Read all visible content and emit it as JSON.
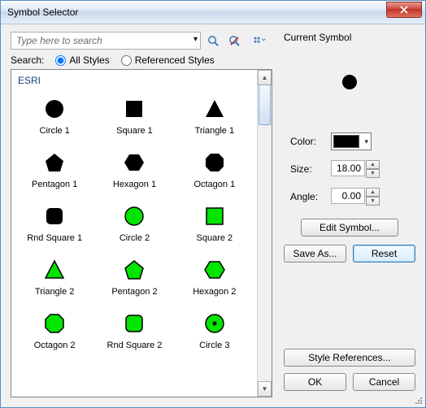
{
  "title": "Symbol Selector",
  "search": {
    "placeholder": "Type here to search",
    "label": "Search:",
    "radio_all": "All Styles",
    "radio_ref": "Referenced Styles"
  },
  "category": "ESRI",
  "symbols": [
    {
      "label": "Circle 1",
      "shape": "circle",
      "fill": "#000"
    },
    {
      "label": "Square 1",
      "shape": "square",
      "fill": "#000"
    },
    {
      "label": "Triangle 1",
      "shape": "triangle",
      "fill": "#000"
    },
    {
      "label": "Pentagon 1",
      "shape": "pentagon",
      "fill": "#000"
    },
    {
      "label": "Hexagon 1",
      "shape": "hexagon",
      "fill": "#000"
    },
    {
      "label": "Octagon 1",
      "shape": "octagon",
      "fill": "#000"
    },
    {
      "label": "Rnd Square 1",
      "shape": "rsquare",
      "fill": "#000"
    },
    {
      "label": "Circle 2",
      "shape": "circle",
      "fill": "#00E400",
      "stroke": "#000"
    },
    {
      "label": "Square 2",
      "shape": "square",
      "fill": "#00E400",
      "stroke": "#000"
    },
    {
      "label": "Triangle 2",
      "shape": "triangle",
      "fill": "#00E400",
      "stroke": "#000"
    },
    {
      "label": "Pentagon 2",
      "shape": "pentagon",
      "fill": "#00E400",
      "stroke": "#000"
    },
    {
      "label": "Hexagon 2",
      "shape": "hexagon",
      "fill": "#00E400",
      "stroke": "#000"
    },
    {
      "label": "Octagon 2",
      "shape": "octagon",
      "fill": "#00E400",
      "stroke": "#000"
    },
    {
      "label": "Rnd Square 2",
      "shape": "rsquare",
      "fill": "#00E400",
      "stroke": "#000"
    },
    {
      "label": "Circle 3",
      "shape": "circle-dot",
      "fill": "#00E400",
      "stroke": "#000"
    }
  ],
  "current": {
    "label": "Current Symbol",
    "color_label": "Color:",
    "color_value": "#000000",
    "size_label": "Size:",
    "size_value": "18.00",
    "angle_label": "Angle:",
    "angle_value": "0.00"
  },
  "buttons": {
    "edit": "Edit Symbol...",
    "saveas": "Save As...",
    "reset": "Reset",
    "style_ref": "Style References...",
    "ok": "OK",
    "cancel": "Cancel"
  }
}
